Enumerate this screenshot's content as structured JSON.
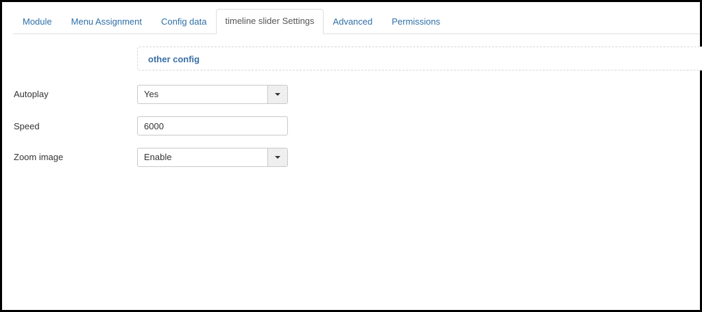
{
  "tabs": [
    {
      "label": "Module",
      "active": false
    },
    {
      "label": "Menu Assignment",
      "active": false
    },
    {
      "label": "Config data",
      "active": false
    },
    {
      "label": "timeline slider Settings",
      "active": true
    },
    {
      "label": "Advanced",
      "active": false
    },
    {
      "label": "Permissions",
      "active": false
    }
  ],
  "section": {
    "title": "other config"
  },
  "form": {
    "autoplay": {
      "label": "Autoplay",
      "value": "Yes"
    },
    "speed": {
      "label": "Speed",
      "value": "6000"
    },
    "zoom_image": {
      "label": "Zoom image",
      "value": "Enable"
    }
  },
  "colors": {
    "link": "#2f6fa7",
    "section_title": "#3a6ea5",
    "border": "#dddddd"
  },
  "icons": {
    "dropdown": "caret-down-icon"
  }
}
